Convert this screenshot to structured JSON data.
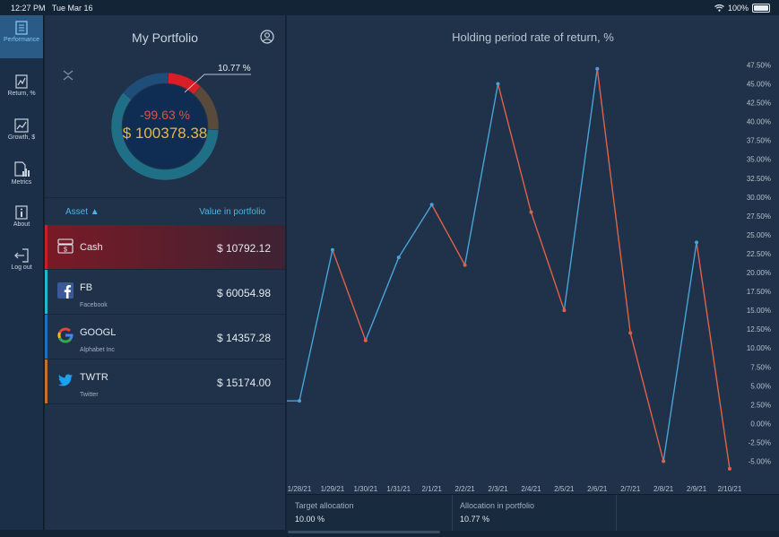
{
  "status_bar": {
    "time": "12:27 PM",
    "date": "Tue Mar 16",
    "battery": "100%"
  },
  "sidebar": {
    "items": [
      {
        "label": "Performance",
        "icon": "document-icon",
        "active": true
      },
      {
        "label": "Return, %",
        "icon": "return-chart-icon"
      },
      {
        "label": "Growth, $",
        "icon": "growth-chart-icon"
      },
      {
        "label": "Metrics",
        "icon": "metrics-icon"
      },
      {
        "label": "About",
        "icon": "info-icon"
      },
      {
        "label": "Log out",
        "icon": "logout-icon"
      }
    ]
  },
  "portfolio": {
    "title": "My Portfolio",
    "donut_callout": "10.77 %",
    "return_pct": "-99.63 %",
    "total_value": "$ 100378.38",
    "donut_slices": [
      {
        "asset": "Cash",
        "fraction": 0.1077,
        "color": "#d81e26"
      },
      {
        "asset": "GOOGL",
        "fraction": 0.1431,
        "color": "#5a4a3c"
      },
      {
        "asset": "FB",
        "fraction": 0.5983,
        "color": "#1f6f86"
      },
      {
        "asset": "TWTR",
        "fraction": 0.1512,
        "color": "#1e4d7a"
      }
    ],
    "list_header": {
      "asset": "Asset ▲",
      "value": "Value in portfolio"
    },
    "assets": [
      {
        "symbol": "Cash",
        "name": "",
        "value": "$ 10792.12",
        "accent": "#c0202a"
      },
      {
        "symbol": "FB",
        "name": "Facebook",
        "value": "$ 60054.98",
        "accent": "#1fb8c9"
      },
      {
        "symbol": "GOOGL",
        "name": "Alphabet Inc",
        "value": "$ 14357.28",
        "accent": "#1d6fc4"
      },
      {
        "symbol": "TWTR",
        "name": "Twitter",
        "value": "$ 15174.00",
        "accent": "#c7702a"
      }
    ]
  },
  "chart_data": {
    "type": "line",
    "title": "Holding period rate of return, %",
    "x": [
      "1/28/21",
      "1/29/21",
      "1/30/21",
      "1/31/21",
      "2/1/21",
      "2/2/21",
      "2/3/21",
      "2/4/21",
      "2/5/21",
      "2/6/21",
      "2/7/21",
      "2/8/21",
      "2/9/21",
      "2/10/21"
    ],
    "values": [
      3.0,
      23.0,
      11.0,
      22.0,
      29.0,
      21.0,
      45.0,
      28.0,
      15.0,
      47.0,
      12.0,
      -5.0,
      24.0,
      -6.0
    ],
    "ylim": [
      -5.0,
      47.5
    ],
    "y_ticks": [
      "47.50%",
      "45.00%",
      "42.50%",
      "40.00%",
      "37.50%",
      "35.00%",
      "32.50%",
      "30.00%",
      "27.50%",
      "25.00%",
      "22.50%",
      "20.00%",
      "17.50%",
      "15.00%",
      "12.50%",
      "10.00%",
      "7.50%",
      "5.00%",
      "2.50%",
      "0.00%",
      "-2.50%",
      "-5.00%"
    ],
    "colors": {
      "up": "#4aa3d8",
      "down": "#e0604a"
    },
    "grid": false
  },
  "allocation": [
    {
      "label": "Target allocation",
      "value": "10.00 %"
    },
    {
      "label": "Allocation in portfolio",
      "value": "10.77 %"
    }
  ]
}
